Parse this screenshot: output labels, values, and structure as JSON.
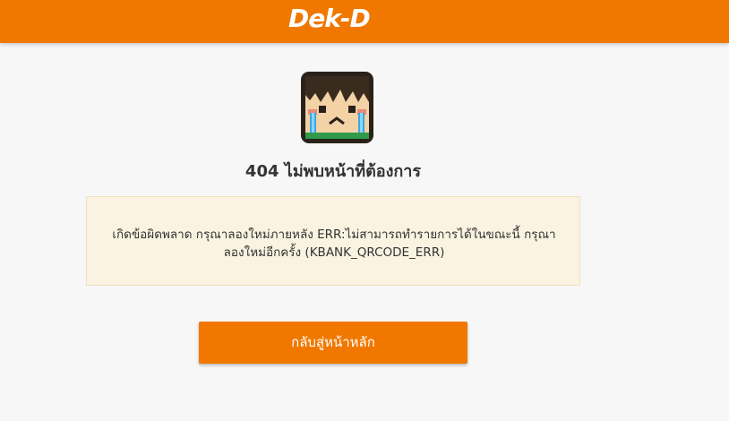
{
  "header": {
    "logo_text": "Dek-D",
    "bar_color": "#f07800"
  },
  "mascot": {
    "icon": "crying-face-icon"
  },
  "error": {
    "title": "404 ไม่พบหน้าที่ต้องการ",
    "message": "เกิดข้อผิดพลาด กรุณาลองใหม่ภายหลัง ERR:ไม่สามารถทำรายการได้ในขณะนี้ กรุณาลองใหม่อีกครั้ง (KBANK_QRCODE_ERR)"
  },
  "actions": {
    "home_button_label": "กลับสู่หน้าหลัก"
  }
}
